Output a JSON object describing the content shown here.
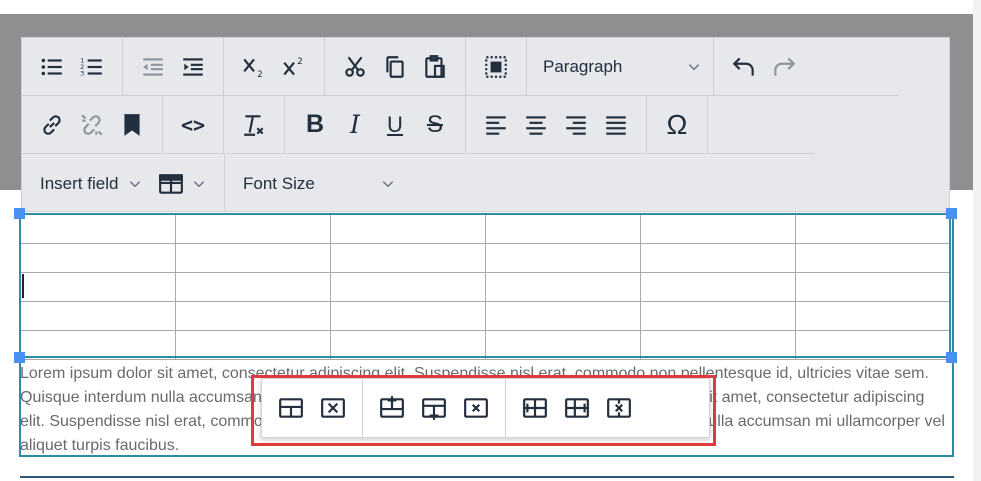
{
  "toolbar": {
    "row1": {
      "buttons": [
        "bullet-list-icon",
        "numbered-list-icon",
        "outdent-icon",
        "indent-icon",
        "subscript-icon",
        "superscript-icon",
        "cut-icon",
        "copy-icon",
        "paste-icon",
        "select-all-icon",
        "undo-icon",
        "redo-icon"
      ],
      "paragraph_select": "Paragraph"
    },
    "row2": {
      "buttons": [
        "link-icon",
        "unlink-icon",
        "bookmark-icon",
        "code-icon",
        "clear-format-icon",
        "bold-icon",
        "italic-icon",
        "underline-icon",
        "strikethrough-icon",
        "align-left-icon",
        "align-center-icon",
        "align-right-icon",
        "justify-icon",
        "special-char-icon"
      ],
      "bold": "B",
      "italic": "I",
      "underline": "U",
      "strike": "S",
      "omega": "Ω",
      "code": "<>"
    },
    "row3": {
      "insert_field": "Insert field",
      "font_size": "Font Size"
    }
  },
  "editor": {
    "table": {
      "rows": 5,
      "cols": 6
    },
    "paragraph": "Lorem ipsum dolor sit amet, consectetur adipiscing elit. Suspendisse nisl erat, commodo non pellentesque id, ultricies vitae sem. Quisque interdum nulla accumsan mi ullamcorper vel aliquet turpis faucibus. Lorem ipsum dolor sit amet, consectetur adipiscing elit. Suspendisse nisl erat, commodo non pellentesque id, ultricies vitae sem. Quisque interdum nulla accumsan mi ullamcorper vel aliquet turpis faucibus."
  },
  "context_toolbar": {
    "buttons": [
      "table-properties-icon",
      "delete-table-icon",
      "insert-row-before-icon",
      "insert-row-after-icon",
      "delete-row-icon",
      "insert-col-before-icon",
      "insert-col-after-icon",
      "delete-col-icon"
    ]
  },
  "colors": {
    "accent": "#2b8ea6",
    "highlight": "#e0393e",
    "icon": "#222f3e"
  }
}
